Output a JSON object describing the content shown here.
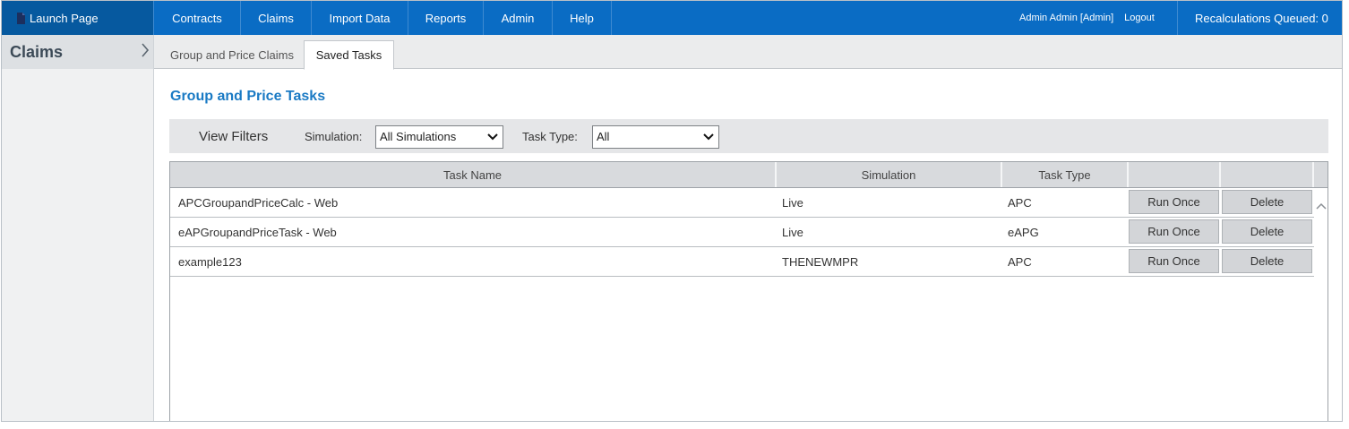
{
  "topbar": {
    "launch_label": "Launch Page",
    "nav": [
      {
        "label": "Contracts"
      },
      {
        "label": "Claims"
      },
      {
        "label": "Import Data"
      },
      {
        "label": "Reports"
      },
      {
        "label": "Admin"
      },
      {
        "label": "Help"
      }
    ],
    "user": "Admin Admin [Admin]",
    "logout": "Logout",
    "recalc": "Recalculations Queued: 0"
  },
  "sidebar": {
    "title": "Claims"
  },
  "tabs": [
    {
      "label": "Group and Price Claims",
      "active": false
    },
    {
      "label": "Saved Tasks",
      "active": true
    }
  ],
  "main": {
    "title": "Group and Price Tasks",
    "filters": {
      "view_label": "View Filters",
      "simulation_label": "Simulation:",
      "simulation_value": "All Simulations",
      "tasktype_label": "Task Type:",
      "tasktype_value": "All"
    },
    "grid": {
      "columns": [
        "Task Name",
        "Simulation",
        "Task Type",
        "",
        ""
      ],
      "rows": [
        {
          "task_name": "APCGroupandPriceCalc - Web",
          "simulation": "Live",
          "task_type": "APC",
          "run": "Run Once",
          "delete": "Delete"
        },
        {
          "task_name": "eAPGroupandPriceTask - Web",
          "simulation": "Live",
          "task_type": "eAPG",
          "run": "Run Once",
          "delete": "Delete"
        },
        {
          "task_name": "example123",
          "simulation": "THENEWMPR",
          "task_type": "APC",
          "run": "Run Once",
          "delete": "Delete"
        }
      ]
    }
  },
  "icons": {
    "launch": "document-icon",
    "sidebar_toggle": "chevron-right-icon",
    "select": "chevron-down-icon",
    "scroll": "chevron-up-icon"
  },
  "colors": {
    "nav_blue": "#0a6cc4",
    "launch_blue": "#06599f",
    "title_blue": "#1a7ac4"
  }
}
